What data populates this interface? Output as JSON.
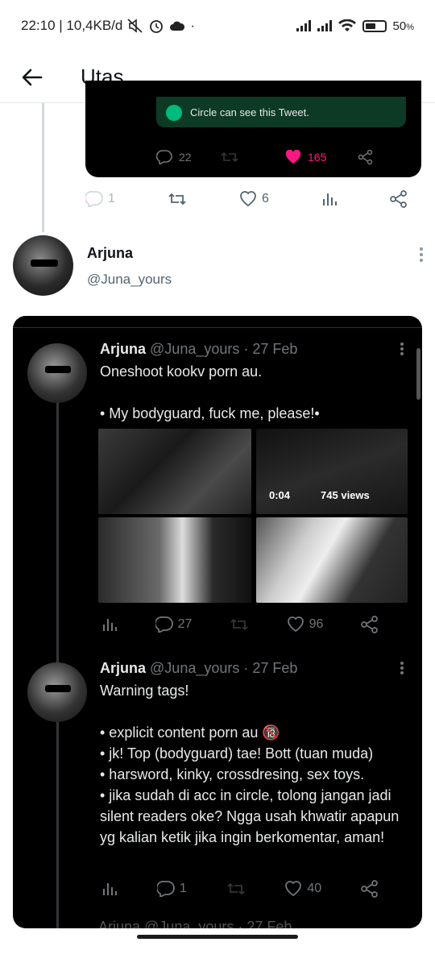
{
  "status_bar": {
    "left_text": "22:10 | 10,4KB/d",
    "dot": "·",
    "battery": "50",
    "battery_unit": "%",
    "icons": [
      "mute-icon",
      "alarm-icon",
      "cloud-icon",
      "signal-icon",
      "signal-icon",
      "wifi-icon",
      "battery-icon"
    ]
  },
  "header": {
    "title": "Utas",
    "back_icon": "arrow-left-icon"
  },
  "top_card": {
    "circle_notice": "Circle can see this Tweet.",
    "replies": "22",
    "likes": "165",
    "like_color": "#f91880"
  },
  "outer_actions": {
    "replies": "1",
    "likes": "6"
  },
  "author": {
    "name": "Arjuna",
    "handle": "@Juna_yours"
  },
  "tweets": [
    {
      "name": "Arjuna",
      "meta": "@Juna_yours · 27 Feb",
      "text": "Oneshoot kookv porn au.\n\n• My bodyguard, fuck me, please!•",
      "video_time": "0:04",
      "video_views": "745 views",
      "replies": "27",
      "likes": "96"
    },
    {
      "name": "Arjuna",
      "meta": "@Juna_yours · 27 Feb",
      "text": "Warning tags!\n\n• explicit content porn au 🔞\n• jk! Top (bodyguard) tae! Bott (tuan muda)\n• harsword, kinky, crossdresing, sex toys.\n• jika sudah di acc in circle, tolong jangan jadi silent readers oke? Ngga usah khwatir apapun yg kalian ketik jika ingin berkomentar, aman!",
      "replies": "1",
      "likes": "40"
    }
  ],
  "peek_text": "Arjuna @Juna_yours · 27 Feb"
}
